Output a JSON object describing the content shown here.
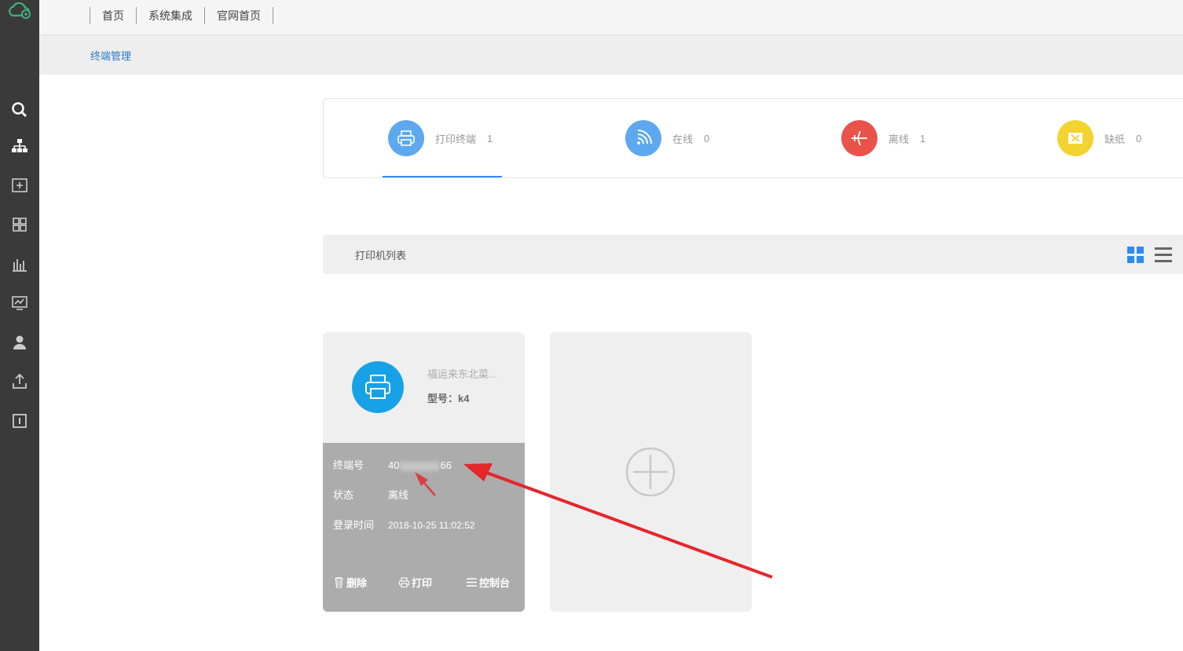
{
  "topnav": {
    "links": [
      "首页",
      "系统集成",
      "官网首页"
    ]
  },
  "breadcrumb": "终端管理",
  "sidebar": {
    "icons": [
      "search-icon",
      "sitemap-icon",
      "add-box-icon",
      "grid-icon",
      "bar-chart-icon",
      "monitor-chart-icon",
      "user-icon",
      "upload-icon",
      "info-box-icon"
    ]
  },
  "stats": [
    {
      "label": "打印终端",
      "count": "1",
      "color": "#5ea8ef",
      "icon": "printer-icon"
    },
    {
      "label": "在线",
      "count": "0",
      "color": "#5ea8ef",
      "icon": "wifi-icon"
    },
    {
      "label": "离线",
      "count": "1",
      "color": "#e9534a",
      "icon": "airplane-icon"
    },
    {
      "label": "缺纸",
      "count": "0",
      "color": "#f3d330",
      "icon": "no-paper-icon"
    }
  ],
  "list": {
    "title": "打印机列表",
    "view_icons": [
      "grid-view-icon",
      "list-view-icon"
    ]
  },
  "printer_card": {
    "name": "福运来东北菜...",
    "model": "型号：k4",
    "terminal_label": "终端号",
    "terminal_value_start": "40",
    "terminal_value_end": "66",
    "status_label": "状态",
    "status_value": "离线",
    "login_label": "登录时间",
    "login_value": "2018-10-25 11:02:52",
    "actions": [
      "删除",
      "打印",
      "控制台"
    ]
  },
  "colors": {
    "sidebar": "#3a3a3a",
    "accent": "#2d8cf0",
    "card_icon": "#17a2e8",
    "annotation": "#e5262b"
  }
}
